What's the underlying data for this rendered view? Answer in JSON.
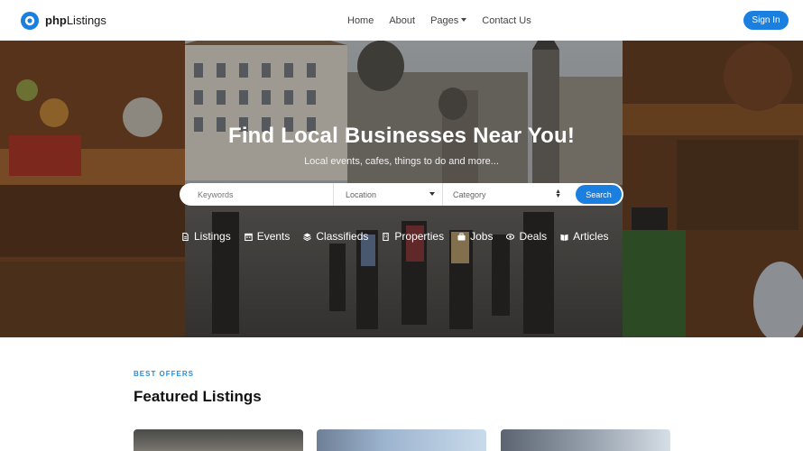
{
  "brand": {
    "name_bold": "php",
    "name_rest": "Listings"
  },
  "nav": {
    "links": [
      {
        "label": "Home"
      },
      {
        "label": "About"
      },
      {
        "label": "Pages",
        "dropdown": true
      },
      {
        "label": "Contact Us"
      }
    ],
    "signin_label": "Sign In"
  },
  "hero": {
    "title": "Find Local Businesses Near You!",
    "subtitle": "Local events, cafes, things to do and more...",
    "search": {
      "keywords_placeholder": "Keywords",
      "location_value": "Location",
      "category_value": "Category",
      "button_label": "Search"
    },
    "categories": [
      {
        "label": "Listings",
        "icon": "document-icon"
      },
      {
        "label": "Events",
        "icon": "calendar-icon"
      },
      {
        "label": "Classifieds",
        "icon": "layers-icon"
      },
      {
        "label": "Properties",
        "icon": "building-icon"
      },
      {
        "label": "Jobs",
        "icon": "briefcase-icon"
      },
      {
        "label": "Deals",
        "icon": "tag-icon"
      },
      {
        "label": "Articles",
        "icon": "book-icon"
      }
    ]
  },
  "content": {
    "eyebrow": "BEST OFFERS",
    "section_title": "Featured Listings"
  },
  "colors": {
    "accent": "#1b7fe0",
    "eyebrow": "#2f8bd8"
  }
}
